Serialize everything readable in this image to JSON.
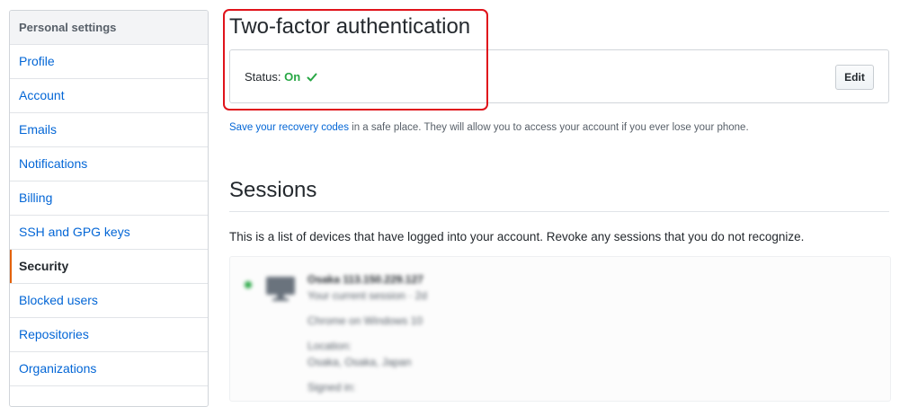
{
  "sidebar": {
    "header": "Personal settings",
    "items": [
      {
        "label": "Profile"
      },
      {
        "label": "Account"
      },
      {
        "label": "Emails"
      },
      {
        "label": "Notifications"
      },
      {
        "label": "Billing"
      },
      {
        "label": "SSH and GPG keys"
      },
      {
        "label": "Security",
        "selected": true
      },
      {
        "label": "Blocked users"
      },
      {
        "label": "Repositories"
      },
      {
        "label": "Organizations"
      }
    ]
  },
  "two_factor": {
    "title": "Two-factor authentication",
    "status_label": "Status:",
    "status_value": "On",
    "edit_label": "Edit",
    "recovery_link": "Save your recovery codes",
    "recovery_text": " in a safe place. They will allow you to access your account if you ever lose your phone."
  },
  "sessions": {
    "title": "Sessions",
    "description": "This is a list of devices that have logged into your account. Revoke any sessions that you do not recognize.",
    "blurred_lines": [
      "Osaka 113.150.229.127",
      "Your current session · 2d",
      "Chrome on Windows 10",
      "Location:",
      "Osaka, Osaka, Japan",
      "Signed in:"
    ]
  },
  "colors": {
    "link": "#0366d6",
    "success": "#28a745",
    "highlight": "#e0131b",
    "selected_accent": "#e36209"
  }
}
